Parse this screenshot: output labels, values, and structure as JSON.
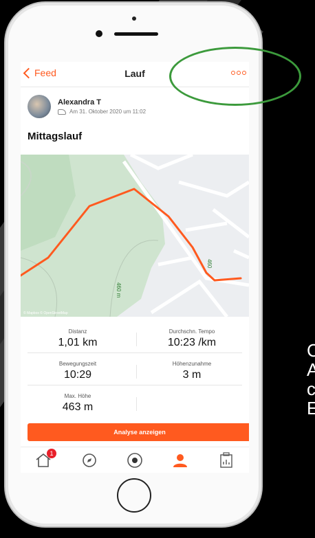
{
  "side_text": "C\nA\nc\nE",
  "nav": {
    "back_label": "Feed",
    "title": "Lauf"
  },
  "user": {
    "name": "Alexandra T",
    "date": "Am 31. Oktober 2020 um 11:02"
  },
  "activity": {
    "title": "Mittagslauf"
  },
  "map": {
    "contour_labels": [
      "460 m",
      "460"
    ],
    "attribution": "© Mapbox © OpenStreetMap"
  },
  "stats": [
    {
      "label": "Distanz",
      "value": "1,01 km"
    },
    {
      "label": "Durchschn. Tempo",
      "value": "10:23 /km"
    },
    {
      "label": "Bewegungszeit",
      "value": "10:29"
    },
    {
      "label": "Höhenzunahme",
      "value": "3 m"
    },
    {
      "label": "Max. Höhe",
      "value": "463 m"
    }
  ],
  "button": {
    "analyse_label": "Analyse anzeigen"
  },
  "tabbar": {
    "home_badge": "1",
    "tabs": [
      "home-icon",
      "compass-icon",
      "record-icon",
      "profile-icon",
      "stats-icon"
    ]
  },
  "colors": {
    "accent": "#ff5a1f",
    "highlight": "#3c9a3c",
    "route": "#ff5a1f"
  }
}
